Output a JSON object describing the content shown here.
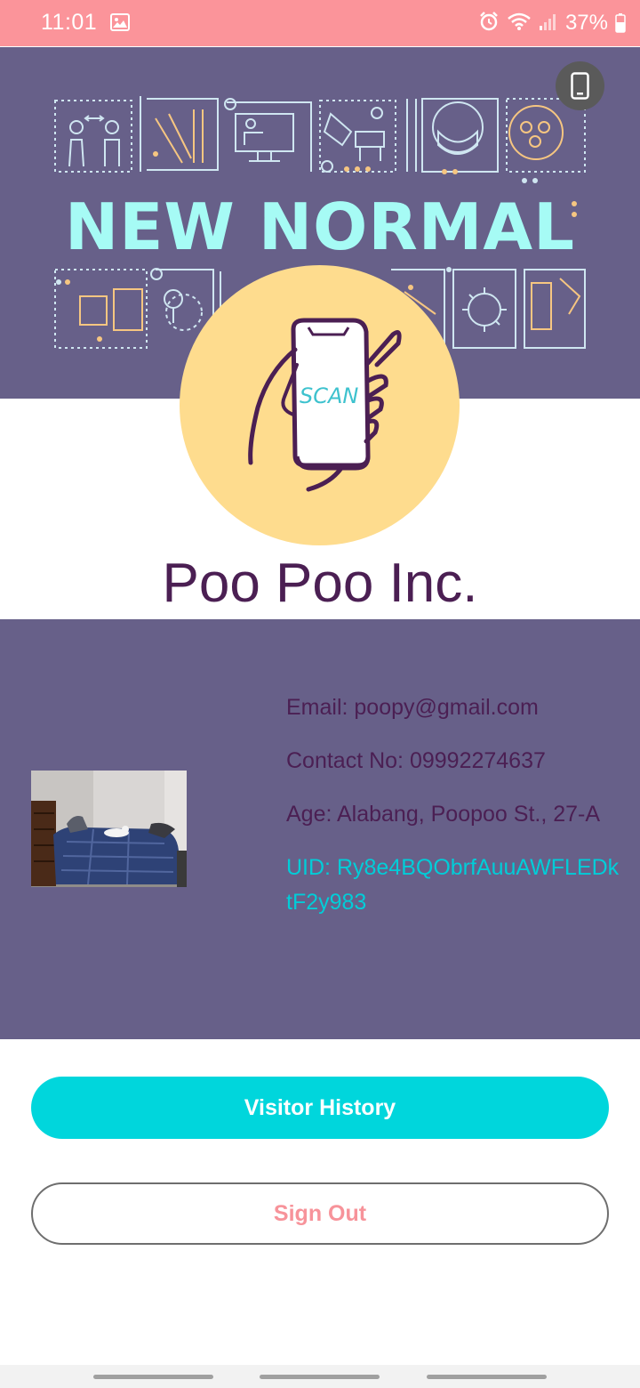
{
  "status_bar": {
    "time": "11:01",
    "battery": "37%",
    "icons": [
      "gallery-icon",
      "alarm-icon",
      "wifi-icon",
      "signal-icon",
      "battery-icon"
    ],
    "background": "#fb949a"
  },
  "banner": {
    "title": "NEW NORMAL",
    "background": "#676089",
    "title_color": "#a6fbf5",
    "device_button_icon": "phone-icon"
  },
  "logo": {
    "text": "SCAN",
    "background": "#fedc8e",
    "icon": "hand-holding-phone-icon"
  },
  "profile": {
    "company": "Poo Poo Inc.",
    "email": "Email: poopy@gmail.com",
    "contact": "Contact No: 09992274637",
    "age": "Age: Alabang, Poopoo St., 27-A",
    "uid": "UID: Ry8e4BQObrfAuuAWFLEDktF2y983",
    "photo_icon": "bedroom-photo"
  },
  "actions": {
    "visitor_history": "Visitor History",
    "sign_out": "Sign Out"
  },
  "colors": {
    "accent": "#00d6dc",
    "dark_text": "#4b1f53",
    "sign_out_text": "#f7939a"
  }
}
